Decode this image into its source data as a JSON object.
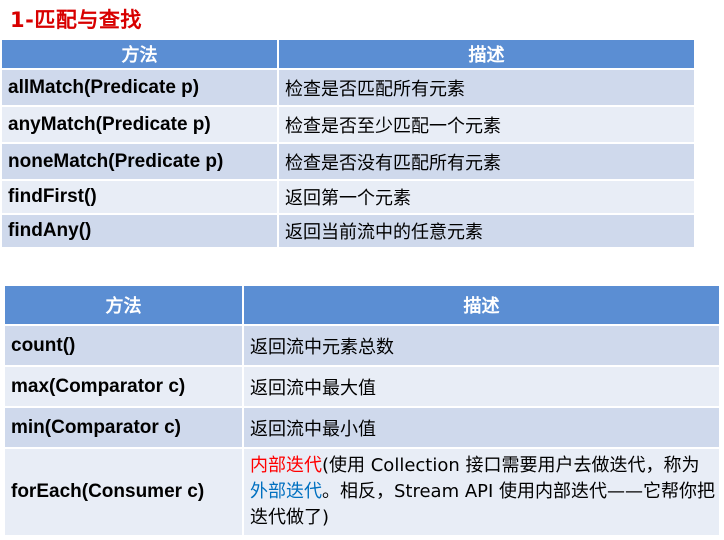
{
  "title": "1-匹配与查找",
  "table1": {
    "headers": [
      "方法",
      "描述"
    ],
    "rows": [
      {
        "method": "allMatch(Predicate p)",
        "desc": "检查是否匹配所有元素"
      },
      {
        "method": "anyMatch(Predicate p)",
        "desc": "检查是否至少匹配一个元素"
      },
      {
        "method": "noneMatch(Predicate  p)",
        "desc": "检查是否没有匹配所有元素"
      },
      {
        "method": "findFirst()",
        "desc": "返回第一个元素"
      },
      {
        "method": "findAny()",
        "desc": "返回当前流中的任意元素"
      }
    ]
  },
  "table2": {
    "headers": [
      "方法",
      "描述"
    ],
    "rows": [
      {
        "method": "count()",
        "desc": "返回流中元素总数"
      },
      {
        "method": "max(Comparator c)",
        "desc": "返回流中最大值"
      },
      {
        "method": "min(Comparator c)",
        "desc": "返回流中最小值"
      }
    ],
    "foreach": {
      "method": "forEach(Consumer c)",
      "part1": "内部迭代",
      "part2": "(使用 Collection 接口需要用户去做迭代，称为",
      "part3": "外部迭代",
      "part4": "。相反，Stream API 使用内部迭代——它帮你把迭代做了)"
    }
  },
  "colors": {
    "header": "#5b8ed3",
    "row_odd": "#cfd9ec",
    "row_even": "#e8edf6",
    "title": "#d80000",
    "highlight_red": "#ff0000",
    "highlight_blue": "#0070c0"
  }
}
